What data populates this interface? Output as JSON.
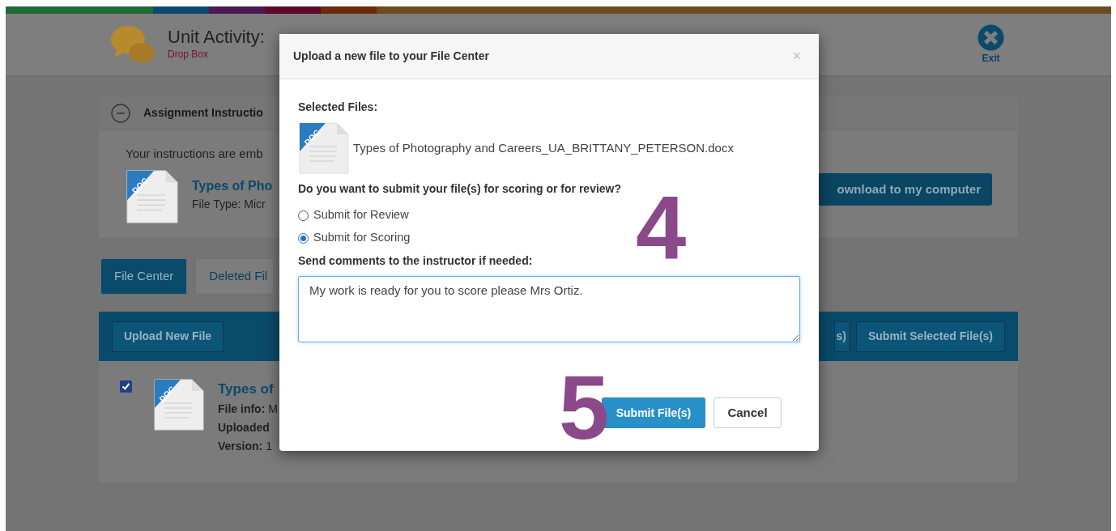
{
  "header": {
    "title": "Unit Activity:",
    "subtitle": "Drop Box",
    "exit_label": "Exit"
  },
  "instructions_card": {
    "title": "Assignment Instructio",
    "expanded": true,
    "text": "Your instructions are emb",
    "file": {
      "badge": "DOC",
      "name": "Types of Pho",
      "type": "File Type: Micr"
    },
    "download_button": "ownload to my computer"
  },
  "tabs": [
    {
      "label": "File Center",
      "selected": true
    },
    {
      "label": "Deleted Fil",
      "selected": false
    }
  ],
  "file_center": {
    "toolbar_left": [
      "Upload New File"
    ],
    "toolbar_right": [
      "s)",
      "Submit Selected File(s)"
    ],
    "files": [
      {
        "checked": true,
        "badge": "DOC",
        "name": "Types of",
        "details": [
          {
            "label": "File info:",
            "value": "M"
          },
          {
            "label": "Uploaded"
          },
          {
            "label": "Version:",
            "value": "1"
          }
        ]
      }
    ]
  },
  "modal": {
    "title": "Upload a new file to your File Center",
    "close": "×",
    "selected_files_label": "Selected Files:",
    "files": [
      {
        "badge": "DOC",
        "name": "Types of Photography and Careers_UA_BRITTANY_PETERSON.docx"
      }
    ],
    "question": "Do you want to submit your file(s) for scoring or for review?",
    "options": [
      {
        "label": "Submit for Review",
        "selected": false
      },
      {
        "label": "Submit for Scoring",
        "selected": true
      }
    ],
    "comments_label": "Send comments to the instructor if needed:",
    "comments_value": "My work is ready for you to score please Mrs Ortiz.",
    "buttons": [
      {
        "label": "Submit File(s)",
        "kind": "primary"
      },
      {
        "label": "Cancel",
        "kind": "secondary"
      }
    ]
  },
  "annotations": [
    {
      "label": "4"
    },
    {
      "label": "5"
    }
  ]
}
